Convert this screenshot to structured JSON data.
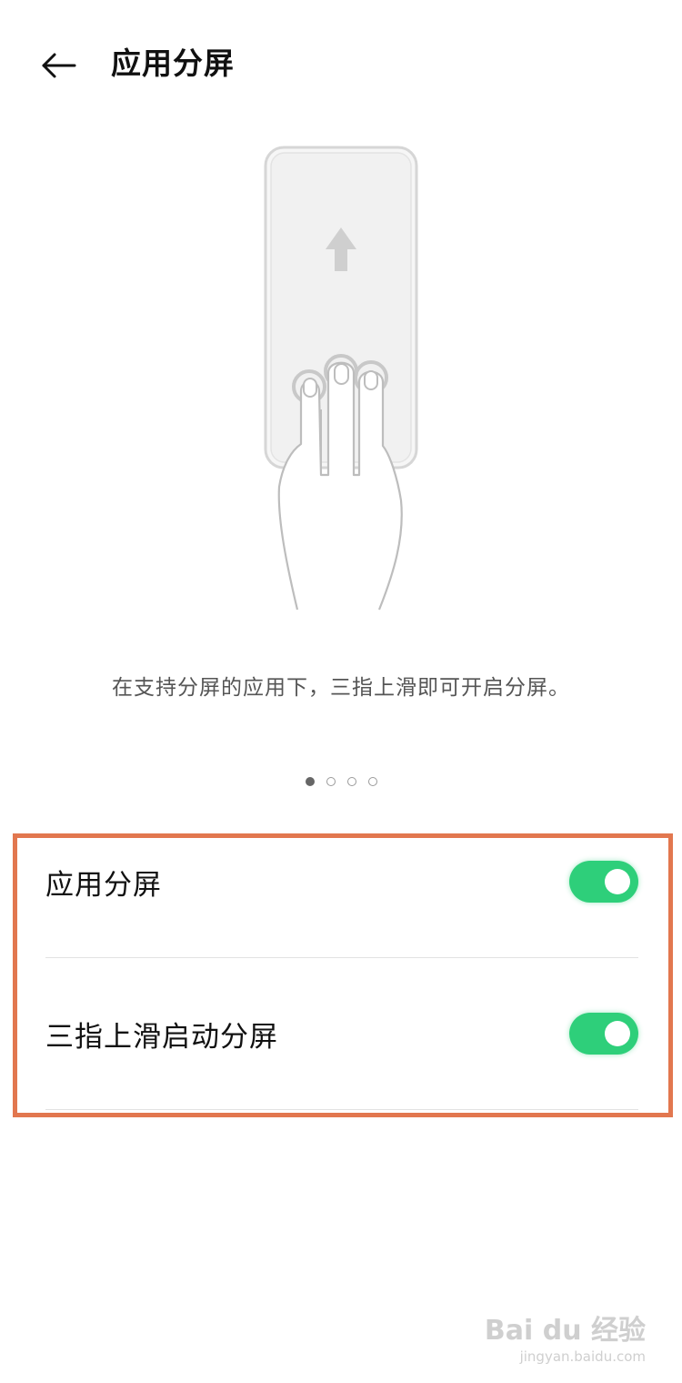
{
  "header": {
    "title": "应用分屏",
    "back_icon": "arrow-left-icon"
  },
  "guide": {
    "hint": "在支持分屏的应用下，三指上滑即可开启分屏。",
    "pages_total": 4,
    "page_active": 1
  },
  "settings": [
    {
      "label": "应用分屏",
      "enabled": true
    },
    {
      "label": "三指上滑启动分屏",
      "enabled": true
    }
  ],
  "colors": {
    "toggle_on": "#2ecf7a",
    "highlight_border": "#e2774f"
  },
  "watermark": {
    "logo": "Bai du 经验",
    "sub": "jingyan.baidu.com"
  }
}
